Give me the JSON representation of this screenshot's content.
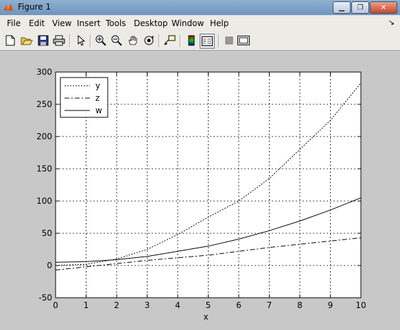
{
  "window": {
    "title": "Figure 1",
    "minimize_glyph": "▁",
    "restore_glyph": "❐",
    "close_glyph": "✕"
  },
  "menu": {
    "items": [
      "File",
      "Edit",
      "View",
      "Insert",
      "Tools",
      "Desktop",
      "Window",
      "Help"
    ],
    "dock_arrow": "↘"
  },
  "toolbar": {
    "icons": [
      "new-figure-icon",
      "open-file-icon",
      "save-icon",
      "print-icon",
      "pointer-icon",
      "zoom-in-icon",
      "zoom-out-icon",
      "pan-hand-icon",
      "rotate-3d-icon",
      "data-cursor-icon",
      "colorbar-icon",
      "legend-icon",
      "hide-plot-tools-icon",
      "show-plot-tools-icon"
    ],
    "active": "legend-icon"
  },
  "chart_data": {
    "type": "line",
    "title": "",
    "xlabel": "x",
    "ylabel": "",
    "xlim": [
      0,
      10
    ],
    "ylim": [
      -50,
      300
    ],
    "xticks": [
      "0",
      "1",
      "2",
      "3",
      "4",
      "5",
      "6",
      "7",
      "8",
      "9",
      "10"
    ],
    "yticks": [
      "-50",
      "0",
      "50",
      "100",
      "150",
      "200",
      "250",
      "300"
    ],
    "grid": true,
    "legend_position": "top-left",
    "series": [
      {
        "name": "y",
        "style": "dotted",
        "x": [
          0,
          1,
          2,
          3,
          4,
          5,
          6,
          7,
          8,
          9,
          10
        ],
        "values": [
          0,
          2,
          10,
          25,
          48,
          75,
          100,
          135,
          180,
          225,
          283
        ]
      },
      {
        "name": "z",
        "style": "dashdot",
        "x": [
          0,
          1,
          2,
          3,
          4,
          5,
          6,
          7,
          8,
          9,
          10
        ],
        "values": [
          -7,
          -2,
          3,
          8,
          12,
          16,
          22,
          28,
          33,
          38,
          43
        ]
      },
      {
        "name": "w",
        "style": "solid",
        "x": [
          0,
          1,
          2,
          3,
          4,
          5,
          6,
          7,
          8,
          9,
          10
        ],
        "values": [
          5,
          6,
          9,
          14,
          22,
          30,
          41,
          54,
          69,
          86,
          105
        ]
      }
    ]
  }
}
